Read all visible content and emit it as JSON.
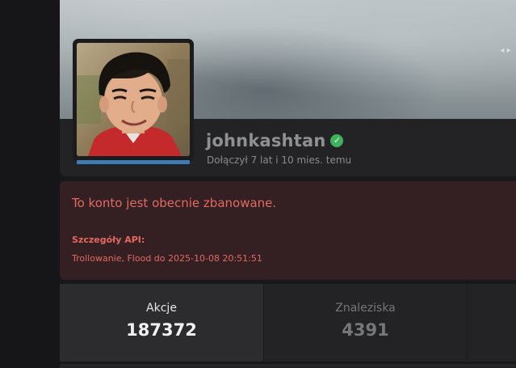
{
  "profile": {
    "username": "johnkashtan",
    "verified": true,
    "joined": "Dołączył 7 lat i 10 mies. temu",
    "avatar_icon": "user-avatar-photo",
    "accent_bar_color": "#3d7bb0"
  },
  "ban": {
    "message": "To konto jest obecnie zbanowane.",
    "details_label": "Szczegóły API:",
    "details_text": "Trollowanie, Flood do 2025-10-08 20:51:51",
    "color": "#e36a62"
  },
  "stats": [
    {
      "label": "Akcje",
      "value": "187372",
      "active": true
    },
    {
      "label": "Znaleziska",
      "value": "4391",
      "active": false
    }
  ]
}
